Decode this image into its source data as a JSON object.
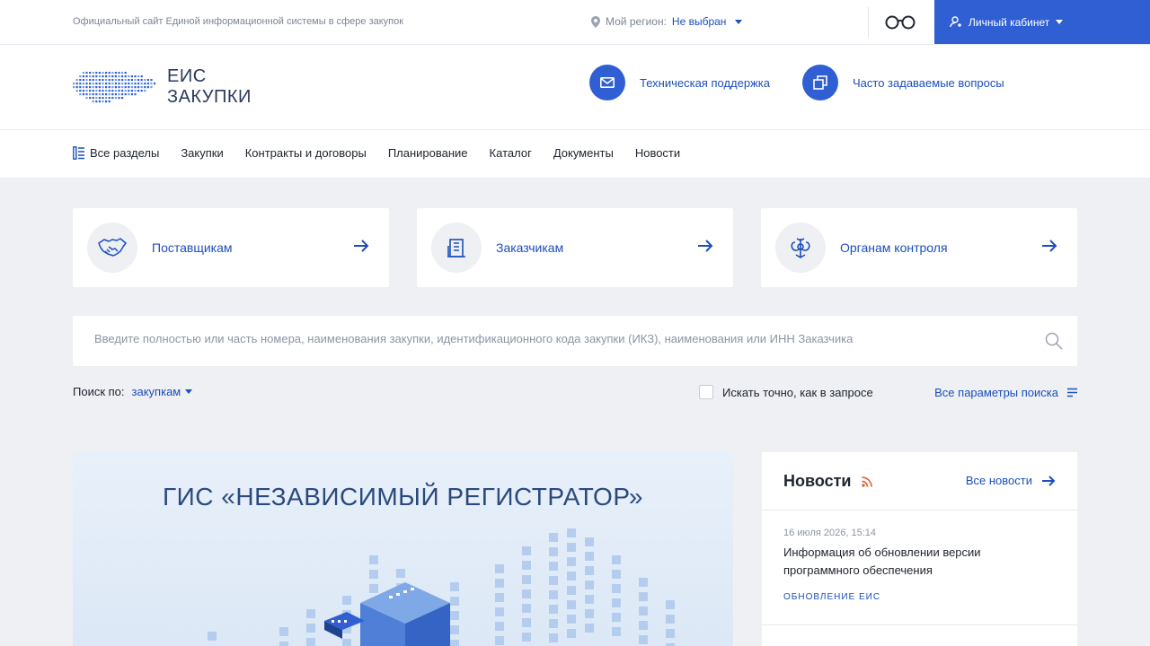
{
  "topbar": {
    "site_title": "Официальный сайт Единой информационной системы в сфере закупок",
    "region_label": "Мой регион:",
    "region_value": "Не выбран",
    "cabinet_label": "Личный кабинет"
  },
  "header": {
    "logo_line1": "ЕИС",
    "logo_line2": "ЗАКУПКИ",
    "support_label": "Техническая поддержка",
    "faq_label": "Часто задаваемые вопросы"
  },
  "nav": {
    "all_sections": "Все разделы",
    "items": [
      "Закупки",
      "Контракты и договоры",
      "Планирование",
      "Каталог",
      "Документы",
      "Новости"
    ]
  },
  "cards": [
    {
      "label": "Поставщикам"
    },
    {
      "label": "Заказчикам"
    },
    {
      "label": "Органам контроля"
    }
  ],
  "search": {
    "placeholder": "Введите полностью или часть номера, наименования закупки, идентификационного кода закупки (ИКЗ), наименования или ИНН Заказчика",
    "by_label": "Поиск по:",
    "by_value": "закупкам",
    "exact_label": "Искать точно, как в запросе",
    "all_params": "Все параметры поиска"
  },
  "banner": {
    "title": "ГИС «НЕЗАВИСИМЫЙ РЕГИСТРАТОР»"
  },
  "news": {
    "title": "Новости",
    "all_label": "Все новости",
    "items": [
      {
        "date": "16 июля 2026, 15:14",
        "text": "Информация об обновлении версии программного обеспечения",
        "tag": "ОБНОВЛЕНИЕ ЕИС"
      }
    ]
  },
  "colors": {
    "accent": "#2f5fd3",
    "link": "#1c4fba",
    "background": "#eef0f4",
    "rss": "#e0643c"
  }
}
